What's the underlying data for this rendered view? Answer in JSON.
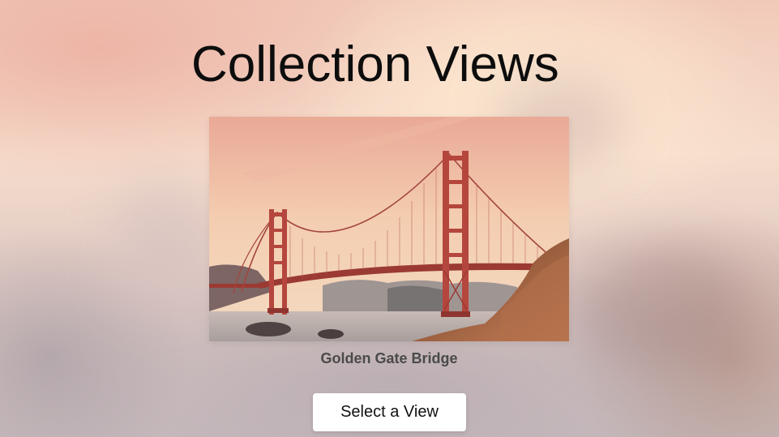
{
  "page": {
    "title": "Collection Views"
  },
  "featured_item": {
    "caption": "Golden Gate Bridge",
    "image_icon": "golden-gate-bridge-photo"
  },
  "actions": {
    "select_view_label": "Select a View"
  },
  "colors": {
    "title_text": "#0d0d0d",
    "caption_text": "#4a4a4a",
    "button_background": "#ffffff",
    "bridge_red": "#b5463e"
  }
}
